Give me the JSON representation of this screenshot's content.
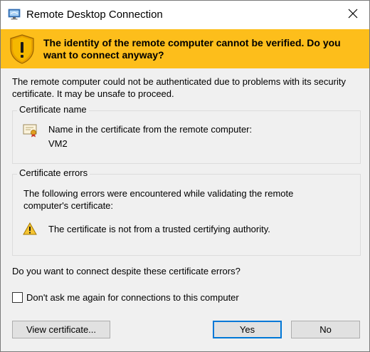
{
  "window": {
    "title": "Remote Desktop Connection"
  },
  "banner": {
    "text": "The identity of the remote computer cannot be verified. Do you want to connect anyway?",
    "color": "#fdbe1b"
  },
  "intro": "The remote computer could not be authenticated due to problems with its security certificate. It may be unsafe to proceed.",
  "cert_name_group": {
    "legend": "Certificate name",
    "label": "Name in the certificate from the remote computer:",
    "value": "VM2"
  },
  "cert_errors_group": {
    "legend": "Certificate errors",
    "description": "The following errors were encountered while validating the remote computer's certificate:",
    "errors": [
      "The certificate is not from a trusted certifying authority."
    ]
  },
  "question": "Do you want to connect despite these certificate errors?",
  "dont_ask": {
    "label": "Don't ask me again for connections to this computer",
    "checked": false
  },
  "buttons": {
    "view_certificate": "View certificate...",
    "yes": "Yes",
    "no": "No"
  },
  "icons": {
    "app": "remote-desktop-icon",
    "close": "close-icon",
    "banner": "warning-shield-icon",
    "certificate": "certificate-icon",
    "error": "warning-triangle-icon"
  },
  "colors": {
    "accent": "#0078d7",
    "dialog_bg": "#f0f0f0"
  }
}
